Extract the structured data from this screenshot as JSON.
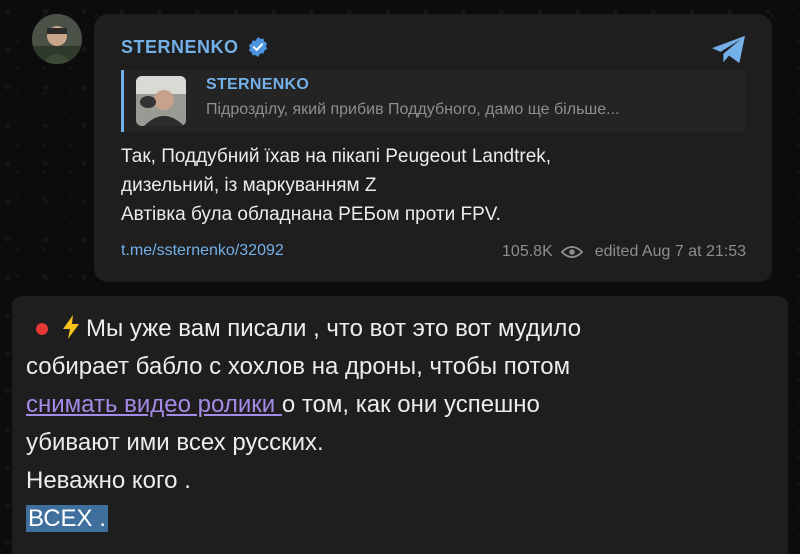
{
  "post": {
    "channel_name": "STERNENKO",
    "reply": {
      "author": "STERNENKO",
      "text": "Підрозділу, який прибив Поддубного, дамо ще більше..."
    },
    "text_lines": [
      "Так, Поддубний їхав на пікапі Peugeout Landtrek,",
      "дизельний, із маркуванням Z",
      "Автівка була обладнана РЕБом проти FPV."
    ],
    "link": "t.me/ssternenko/32092",
    "views": "105.8K",
    "edited": "edited  Aug 7 at 21:53"
  },
  "caption": {
    "line1": "Мы уже вам писали , что вот это вот мудило",
    "line2": "собирает бабло с хохлов на дроны, чтобы потом",
    "line3_link": "снимать видео ролики ",
    "line3_rest": "о том, как они успешно",
    "line4": "убивают ими всех русских.",
    "line5": "Неважно кого .",
    "line6": "ВСЕХ ."
  },
  "icons": {
    "verified": "verified-badge-icon",
    "share": "telegram-share-icon",
    "views": "eye-icon",
    "bullet": "red-circle-icon",
    "lightning": "lightning-icon"
  },
  "colors": {
    "accent": "#74b0e8",
    "link": "#a58be8",
    "highlight": "#3f6f9c",
    "bubble": "#1e1e1e",
    "red": "#e53935"
  }
}
